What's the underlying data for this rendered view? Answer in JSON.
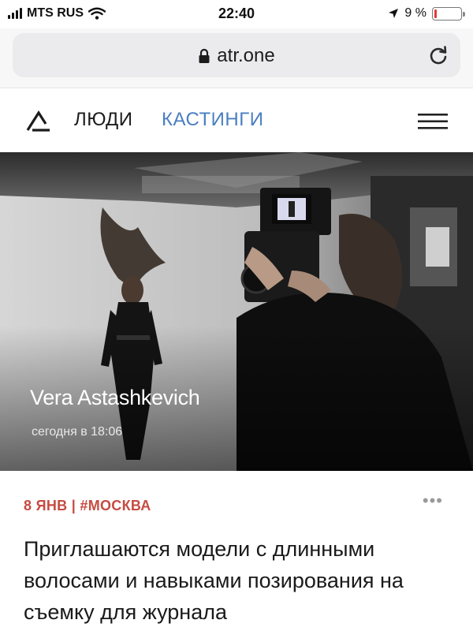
{
  "status_bar": {
    "carrier": "MTS RUS",
    "time": "22:40",
    "battery_percent": "9 %",
    "battery_level": 0.09
  },
  "browser": {
    "url": "atr.one"
  },
  "site_nav": {
    "people": "ЛЮДИ",
    "castings": "КАСТИНГИ"
  },
  "hero": {
    "name": "Vera Astashkevich",
    "time": "сегодня в 18:06"
  },
  "article": {
    "meta": "8 ЯНВ | #МОСКВА",
    "headline": "Приглашаются модели с длинными волосами и навыками позирования на съемку для журнала"
  },
  "colors": {
    "accent_blue": "#4a7fc1",
    "meta_red": "#c64b42",
    "battery_red": "#e23b3b"
  },
  "icons": [
    "signal-icon",
    "wifi-icon",
    "location-arrow-icon",
    "battery-icon",
    "lock-icon",
    "reload-icon",
    "logo-icon",
    "menu-icon",
    "more-icon"
  ]
}
